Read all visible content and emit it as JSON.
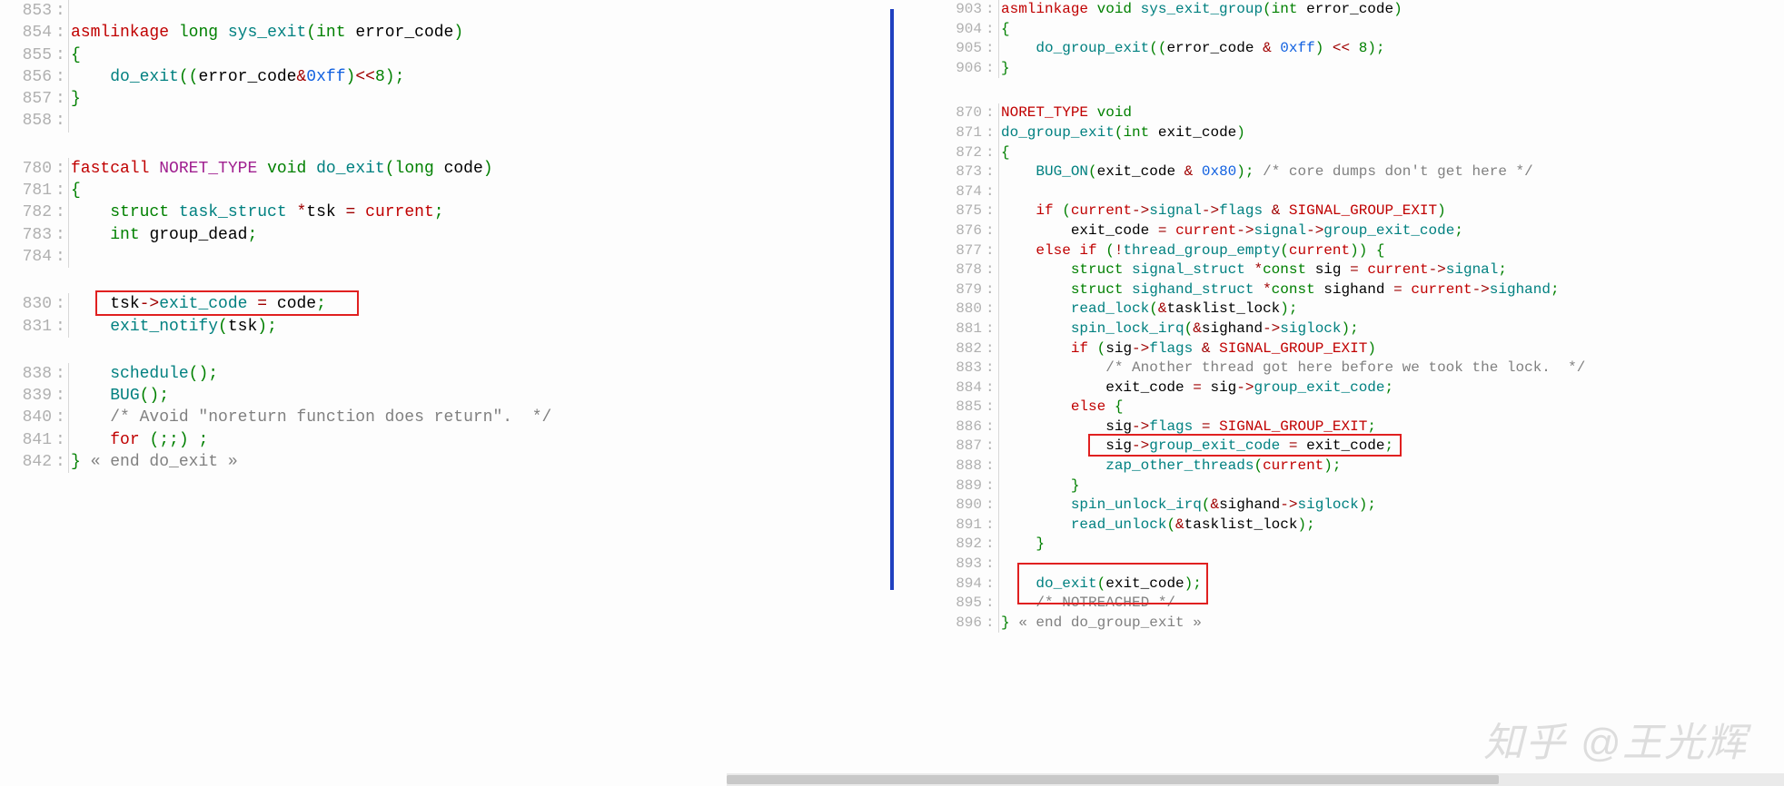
{
  "left": {
    "block1": {
      "l853": "",
      "l854": {
        "sig": "asmlinkage long sys_exit(int error_code)"
      },
      "l855": "{",
      "l856": "    do_exit((error_code&0xff)<<8);",
      "l857": "}",
      "l858": ""
    },
    "block2": {
      "l780": "fastcall NORET_TYPE void do_exit(long code)",
      "l781": "{",
      "l782": "    struct task_struct *tsk = current;",
      "l783": "    int group_dead;",
      "l784": ""
    },
    "block3": {
      "l830": "    tsk->exit_code = code;",
      "l831": "    exit_notify(tsk);"
    },
    "block4": {
      "l838": "    schedule();",
      "l839": "    BUG();",
      "l840": "    /* Avoid \"noreturn function does return\".  */",
      "l841": "    for (;;) ;",
      "l842": "} « end do_exit »"
    }
  },
  "right": {
    "block1": {
      "l903": "asmlinkage void sys_exit_group(int error_code)",
      "l904": "{",
      "l905": "    do_group_exit((error_code & 0xff) << 8);",
      "l906": "}"
    },
    "block2": {
      "l870": "NORET_TYPE void",
      "l871": "do_group_exit(int exit_code)",
      "l872": "{",
      "l873": "    BUG_ON(exit_code & 0x80); /* core dumps don't get here */",
      "l874": "",
      "l875": "    if (current->signal->flags & SIGNAL_GROUP_EXIT)",
      "l876": "        exit_code = current->signal->group_exit_code;",
      "l877": "    else if (!thread_group_empty(current)) {",
      "l878": "        struct signal_struct *const sig = current->signal;",
      "l879": "        struct sighand_struct *const sighand = current->sighand;",
      "l880": "        read_lock(&tasklist_lock);",
      "l881": "        spin_lock_irq(&sighand->siglock);",
      "l882": "        if (sig->flags & SIGNAL_GROUP_EXIT)",
      "l883": "            /* Another thread got here before we took the lock.  */",
      "l884": "            exit_code = sig->group_exit_code;",
      "l885": "        else {",
      "l886": "            sig->flags = SIGNAL_GROUP_EXIT;",
      "l887": "            sig->group_exit_code = exit_code;",
      "l888": "            zap_other_threads(current);",
      "l889": "        }",
      "l890": "        spin_unlock_irq(&sighand->siglock);",
      "l891": "        read_unlock(&tasklist_lock);",
      "l892": "    }",
      "l893": "",
      "l894": "    do_exit(exit_code);",
      "l895": "    /* NOTREACHED */",
      "l896": "} « end do_group_exit »"
    }
  },
  "watermark": "知乎 @王光辉",
  "lineno": {
    "l853": "853",
    "l854": "854",
    "l855": "855",
    "l856": "856",
    "l857": "857",
    "l858": "858",
    "l780": "780",
    "l781": "781",
    "l782": "782",
    "l783": "783",
    "l784": "784",
    "l830": "830",
    "l831": "831",
    "l838": "838",
    "l839": "839",
    "l840": "840",
    "l841": "841",
    "l842": "842",
    "l903": "903",
    "l904": "904",
    "l905": "905",
    "l906": "906",
    "l870": "870",
    "l871": "871",
    "l872": "872",
    "l873": "873",
    "l874": "874",
    "l875": "875",
    "l876": "876",
    "l877": "877",
    "l878": "878",
    "l879": "879",
    "l880": "880",
    "l881": "881",
    "l882": "882",
    "l883": "883",
    "l884": "884",
    "l885": "885",
    "l886": "886",
    "l887": "887",
    "l888": "888",
    "l889": "889",
    "l890": "890",
    "l891": "891",
    "l892": "892",
    "l893": "893",
    "l894": "894",
    "l895": "895",
    "l896": "896"
  },
  "colon": ":"
}
